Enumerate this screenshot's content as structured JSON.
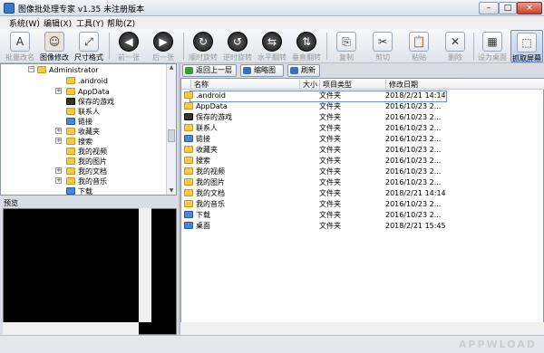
{
  "window": {
    "title": "图像批处理专家 v1.35 未注册版本",
    "min": "–",
    "max": "□",
    "close": "×"
  },
  "menu": [
    "系统(W)",
    "编辑(X)",
    "工具(Y)",
    "帮助(Z)"
  ],
  "toolbar": [
    {
      "label": "批量改名",
      "icon": "rename-icon",
      "glyph": "A"
    },
    {
      "label": "图像修改",
      "icon": "portrait-icon",
      "glyph": "☺"
    },
    {
      "label": "尺寸格式",
      "icon": "resize-icon",
      "glyph": "⤢"
    },
    {
      "label": "前一张",
      "icon": "prev-icon",
      "glyph": "◀"
    },
    {
      "label": "后一张",
      "icon": "next-icon",
      "glyph": "▶"
    },
    {
      "label": "顺时旋转",
      "icon": "rotate-cw-icon",
      "glyph": "↻"
    },
    {
      "label": "逆时旋转",
      "icon": "rotate-ccw-icon",
      "glyph": "↺"
    },
    {
      "label": "水平翻转",
      "icon": "flip-h-icon",
      "glyph": "⇆"
    },
    {
      "label": "垂直翻转",
      "icon": "flip-v-icon",
      "glyph": "⇅"
    },
    {
      "label": "复制",
      "icon": "copy-icon",
      "glyph": "⎘"
    },
    {
      "label": "剪切",
      "icon": "cut-icon",
      "glyph": "✂"
    },
    {
      "label": "粘贴",
      "icon": "paste-icon",
      "glyph": "📋"
    },
    {
      "label": "删除",
      "icon": "delete-icon",
      "glyph": "✕"
    },
    {
      "label": "设为桌面",
      "icon": "wallpaper-icon",
      "glyph": "▦"
    },
    {
      "label": "抓取屏幕",
      "icon": "capture-icon",
      "glyph": "⬚"
    }
  ],
  "tree": [
    {
      "label": "Administrator",
      "indent": 0,
      "exp": "-",
      "color": "yellow"
    },
    {
      "label": ".android",
      "indent": 1,
      "exp": "",
      "color": "yellow"
    },
    {
      "label": "AppData",
      "indent": 1,
      "exp": "+",
      "color": "yellow"
    },
    {
      "label": "保存的游戏",
      "indent": 1,
      "exp": "",
      "color": "dark"
    },
    {
      "label": "联系人",
      "indent": 1,
      "exp": "",
      "color": "yellow"
    },
    {
      "label": "链接",
      "indent": 1,
      "exp": "",
      "color": "blue"
    },
    {
      "label": "收藏夹",
      "indent": 1,
      "exp": "+",
      "color": "yellow"
    },
    {
      "label": "搜索",
      "indent": 1,
      "exp": "+",
      "color": "yellow"
    },
    {
      "label": "我的视频",
      "indent": 1,
      "exp": "",
      "color": "yellow"
    },
    {
      "label": "我的图片",
      "indent": 1,
      "exp": "",
      "color": "yellow"
    },
    {
      "label": "我的文档",
      "indent": 1,
      "exp": "+",
      "color": "yellow"
    },
    {
      "label": "我的音乐",
      "indent": 1,
      "exp": "+",
      "color": "yellow"
    },
    {
      "label": "下载",
      "indent": 1,
      "exp": "",
      "color": "blue"
    }
  ],
  "preview_label": "预览",
  "file_toolbar": {
    "up": "返回上一层",
    "thumb": "缩略图",
    "refresh": "刷新"
  },
  "file_headers": {
    "name": "名称",
    "size": "大小",
    "type": "项目类型",
    "date": "修改日期"
  },
  "files": [
    {
      "name": ".android",
      "type": "文件夹",
      "date": "2018/2/21 14:14",
      "color": "yellow"
    },
    {
      "name": "AppData",
      "type": "文件夹",
      "date": "2016/10/23 2...",
      "color": "yellow"
    },
    {
      "name": "保存的游戏",
      "type": "文件夹",
      "date": "2016/10/23 2...",
      "color": "dark"
    },
    {
      "name": "联系人",
      "type": "文件夹",
      "date": "2016/10/23 2...",
      "color": "yellow"
    },
    {
      "name": "链接",
      "type": "文件夹",
      "date": "2016/10/23 2...",
      "color": "blue"
    },
    {
      "name": "收藏夹",
      "type": "文件夹",
      "date": "2016/10/23 2...",
      "color": "yellow"
    },
    {
      "name": "搜索",
      "type": "文件夹",
      "date": "2016/10/23 2...",
      "color": "yellow"
    },
    {
      "name": "我的视频",
      "type": "文件夹",
      "date": "2016/10/23 2...",
      "color": "yellow"
    },
    {
      "name": "我的图片",
      "type": "文件夹",
      "date": "2016/10/23 2...",
      "color": "yellow"
    },
    {
      "name": "我的文档",
      "type": "文件夹",
      "date": "2018/2/21 14:14",
      "color": "yellow"
    },
    {
      "name": "我的音乐",
      "type": "文件夹",
      "date": "2016/10/23 2...",
      "color": "yellow"
    },
    {
      "name": "下载",
      "type": "文件夹",
      "date": "2016/10/23 2...",
      "color": "blue"
    },
    {
      "name": "桌面",
      "type": "文件夹",
      "date": "2018/2/21 15:45",
      "color": "blue"
    }
  ],
  "watermark": "APPWLOAD"
}
